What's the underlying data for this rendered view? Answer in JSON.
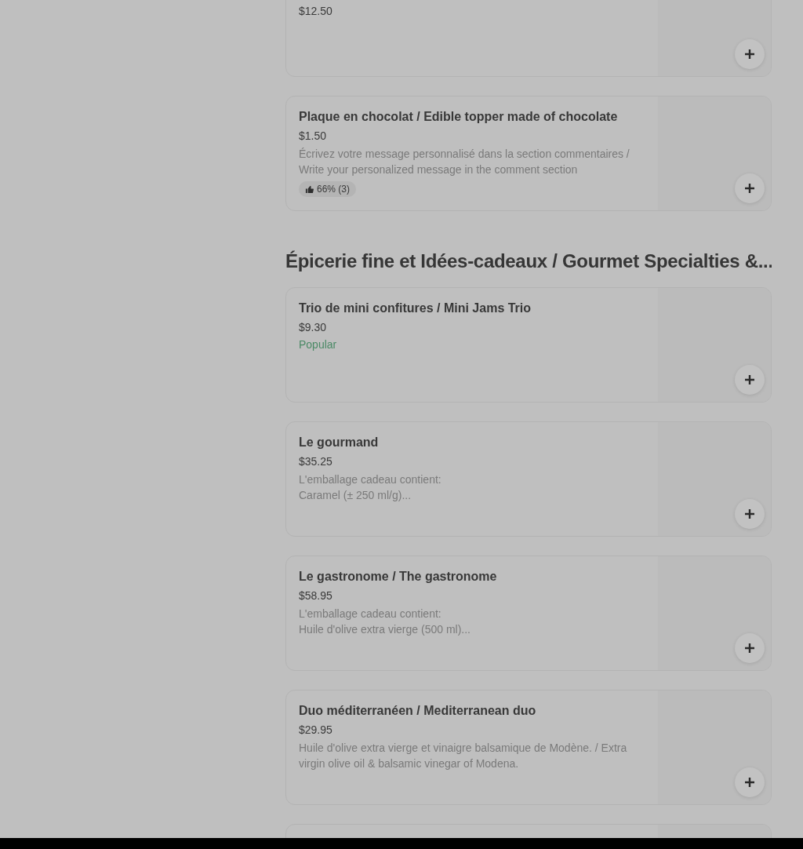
{
  "sections": [
    {
      "items": [
        {
          "kind": "cut",
          "price": "$12.50"
        },
        {
          "kind": "item",
          "title": "Plaque en chocolat / Edible topper made of chocolate",
          "price": "$1.50",
          "description": "Écrivez votre message personnalisé dans la section commentaires / Write your personalized message in the comment section",
          "rating": "66% (3)"
        }
      ]
    },
    {
      "heading": "Épicerie fine et Idées-cadeaux / Gourmet Specialties &...",
      "items": [
        {
          "kind": "item",
          "title": "Trio de mini confitures / Mini Jams Trio",
          "price": "$9.30",
          "tag": "Popular"
        },
        {
          "kind": "item",
          "title": "Le gourmand",
          "price": "$35.25",
          "description": "L'emballage cadeau contient:\nCaramel (± 250 ml/g)..."
        },
        {
          "kind": "item",
          "title": "Le gastronome / The gastronome",
          "price": "$58.95",
          "description": "L'emballage cadeau contient:\nHuile d'olive extra vierge (500 ml)..."
        },
        {
          "kind": "item",
          "title": "Duo méditerranéen / Mediterranean duo",
          "price": "$29.95",
          "description": "Huile d'olive extra vierge et vinaigre balsamique de Modène. / Extra virgin olive oil & balsamic vinegar of Modena."
        },
        {
          "kind": "edge"
        }
      ]
    }
  ]
}
